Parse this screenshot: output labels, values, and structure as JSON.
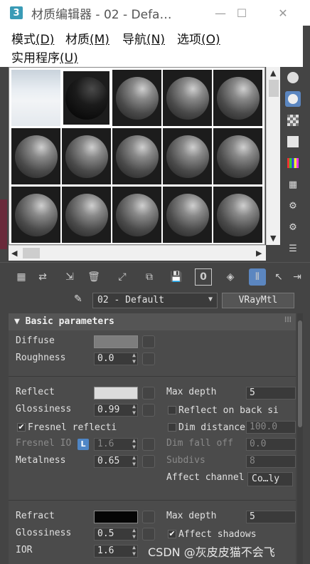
{
  "window": {
    "title": "材质编辑器 - 02 - Defa…",
    "app_icon": "3",
    "minimize": "—",
    "maximize": "☐",
    "close": "✕"
  },
  "menu": {
    "items": [
      {
        "label": "模式",
        "key": "(D)"
      },
      {
        "label": "材质",
        "key": "(M)"
      },
      {
        "label": "导航",
        "key": "(N)"
      },
      {
        "label": "选项",
        "key": "(O)"
      },
      {
        "label": "实用程序",
        "key": "(U)"
      }
    ]
  },
  "material": {
    "name": "02 - Default",
    "type": "VRayMtl"
  },
  "basic": {
    "title": "Basic parameters",
    "diffuse": {
      "label": "Diffuse",
      "color": "#7d7d7d"
    },
    "roughness": {
      "label": "Roughness",
      "value": "0.0"
    },
    "reflect": {
      "label": "Reflect",
      "color": "#dcdcdc"
    },
    "max_depth_r": {
      "label": "Max depth",
      "value": "5"
    },
    "glossiness_r": {
      "label": "Glossiness",
      "value": "0.99"
    },
    "reflect_back": {
      "label": "Reflect on back si"
    },
    "fresnel": {
      "label": "Fresnel reflecti"
    },
    "dim_distance": {
      "label": "Dim distance",
      "value": "100.0"
    },
    "fresnel_ior": {
      "label": "Fresnel IO",
      "value": "1.6",
      "lock": "L"
    },
    "dim_falloff": {
      "label": "Dim fall off",
      "value": "0.0"
    },
    "metalness": {
      "label": "Metalness",
      "value": "0.65"
    },
    "subdivs": {
      "label": "Subdivs",
      "value": "8"
    },
    "affect_channels": {
      "label": "Affect channel",
      "value": "Co…ly"
    },
    "refract": {
      "label": "Refract",
      "color": "#050505"
    },
    "max_depth_f": {
      "label": "Max depth",
      "value": "5"
    },
    "glossiness_f": {
      "label": "Glossiness",
      "value": "0.5"
    },
    "affect_shadows": {
      "label": "Affect shadows"
    },
    "ior": {
      "label": "IOR",
      "value": "1.6"
    }
  },
  "watermark": "CSDN @灰皮皮猫不会飞"
}
